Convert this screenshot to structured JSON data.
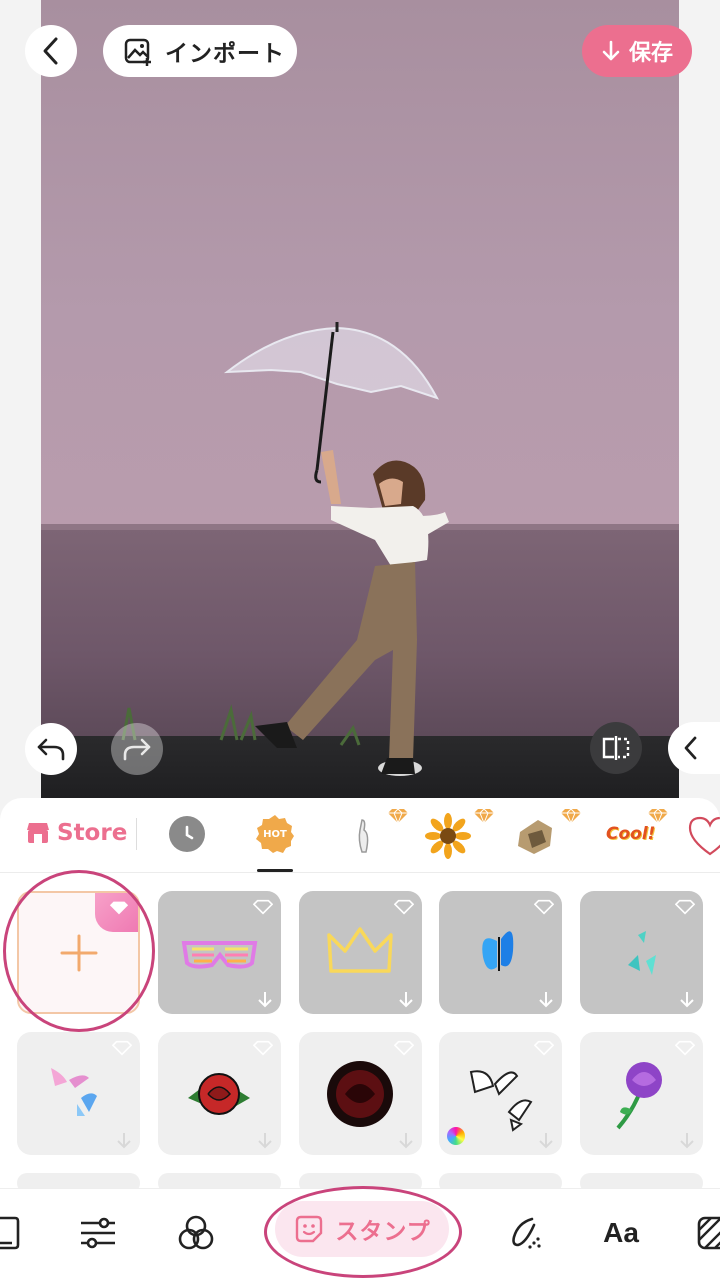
{
  "header": {
    "import_label": "インポート",
    "save_label": "保存"
  },
  "tabs": {
    "store_label": "Store",
    "hot_label": "HOT",
    "cool_label": "Cool!",
    "categories": [
      "recent-icon",
      "hot-icon",
      "hand-sticker",
      "sunflower-sticker",
      "craft-sticker",
      "cool-text-sticker",
      "heart-sticker"
    ]
  },
  "stickers": {
    "row1": [
      "add-custom-sticker",
      "neon-shutter-glasses",
      "neon-crown",
      "blue-butterfly",
      "teal-butterflies"
    ],
    "row2": [
      "pink-blue-butterflies",
      "rose-tattoo",
      "dark-red-rose",
      "sketch-butterflies",
      "purple-rose"
    ]
  },
  "toolbar": {
    "stamp_label": "スタンプ",
    "text_label": "Aa",
    "tools": [
      "frame-icon",
      "adjust-icon",
      "filter-icon",
      "stamp-icon",
      "brush-icon",
      "text-icon",
      "texture-icon"
    ]
  },
  "colors": {
    "accent": "#ec6f8f",
    "highlight_ring": "#c9447b",
    "gem": "#f0a94a"
  }
}
